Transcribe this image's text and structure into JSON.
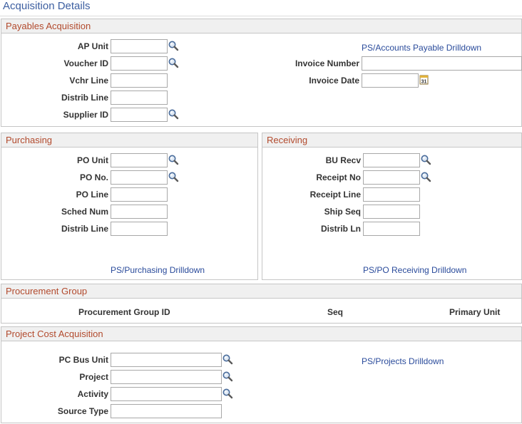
{
  "page": {
    "title": "Acquisition Details"
  },
  "payables": {
    "heading": "Payables Acquisition",
    "ap_unit_label": "AP Unit",
    "voucher_id_label": "Voucher ID",
    "vchr_line_label": "Vchr Line",
    "distrib_line_label": "Distrib Line",
    "supplier_id_label": "Supplier ID",
    "invoice_number_label": "Invoice Number",
    "invoice_date_label": "Invoice Date",
    "drilldown_link": "PS/Accounts Payable Drilldown",
    "values": {
      "ap_unit": "",
      "voucher_id": "",
      "vchr_line": "",
      "distrib_line": "",
      "supplier_id": "",
      "invoice_number": "",
      "invoice_date": ""
    }
  },
  "purchasing": {
    "heading": "Purchasing",
    "po_unit_label": "PO Unit",
    "po_no_label": "PO No.",
    "po_line_label": "PO Line",
    "sched_num_label": "Sched Num",
    "distrib_line_label": "Distrib Line",
    "drilldown_link": "PS/Purchasing Drilldown"
  },
  "receiving": {
    "heading": "Receiving",
    "bu_recv_label": "BU Recv",
    "receipt_no_label": "Receipt No",
    "receipt_line_label": "Receipt Line",
    "ship_seq_label": "Ship Seq",
    "distrib_ln_label": "Distrib Ln",
    "drilldown_link": "PS/PO Receiving Drilldown"
  },
  "procurement": {
    "heading": "Procurement Group",
    "columns": [
      "Procurement Group ID",
      "Seq",
      "Primary Unit"
    ]
  },
  "project": {
    "heading": "Project Cost Acquisition",
    "pc_bus_unit_label": "PC Bus Unit",
    "project_label": "Project",
    "activity_label": "Activity",
    "source_type_label": "Source Type",
    "drilldown_link": "PS/Projects Drilldown"
  },
  "icons": {
    "lookup": "magnifier-icon",
    "calendar": "calendar-icon"
  },
  "colors": {
    "heading": "#b24a2d",
    "link": "#2a4b9b",
    "title": "#3c5ea0"
  }
}
